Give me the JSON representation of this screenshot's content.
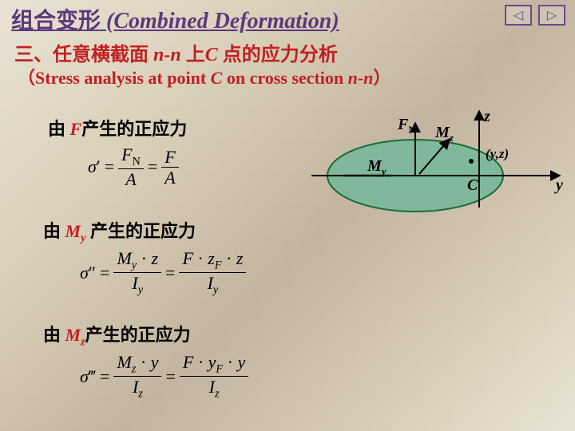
{
  "title": {
    "cn": "组合变形",
    "en": "(Combined Deformation)"
  },
  "nav": {
    "prev_glyph": "◁",
    "next_glyph": "▷"
  },
  "heading": {
    "prefix": "三、任意横截面 ",
    "nn": "n-n",
    "mid": " 上",
    "C": "C",
    "suffix": " 点的应力分析"
  },
  "subheading": {
    "open": "（",
    "t1": "Stress analysis at point ",
    "C": "C",
    "t2": " on cross section ",
    "nn": "n-n",
    "close": "）"
  },
  "line1": {
    "pre": "由 ",
    "F": "F",
    "post": "产生的正应力"
  },
  "line2": {
    "pre": "由 ",
    "M": "M",
    "sub": "y",
    "post": " 产生的正应力"
  },
  "line3": {
    "pre": "由 ",
    "M": "M",
    "sub": "z",
    "post": "产生的正应力"
  },
  "formula1": {
    "sigma": "σ",
    "prime": "′",
    "FN": "F",
    "FNs": "N",
    "A": "A",
    "F": "F"
  },
  "formula2": {
    "sigma": "σ",
    "prime": "″",
    "My": "M",
    "Mys": "y",
    "z": "z",
    "Iy": "I",
    "Iys": "y",
    "F": "F",
    "zF": "z",
    "zFs": "F"
  },
  "formula3": {
    "sigma": "σ",
    "prime": "‴",
    "Mz": "M",
    "Mzs": "z",
    "y": "y",
    "Iz": "I",
    "Izs": "z",
    "F": "F",
    "yF": "y",
    "yFs": "F"
  },
  "diagram": {
    "FN": "F",
    "FNs": "N",
    "Mz": "M",
    "Mzs": "z",
    "My": "M",
    "Mys": "y",
    "z": "z",
    "y": "y",
    "C": "C",
    "pt": "(y,z)"
  }
}
